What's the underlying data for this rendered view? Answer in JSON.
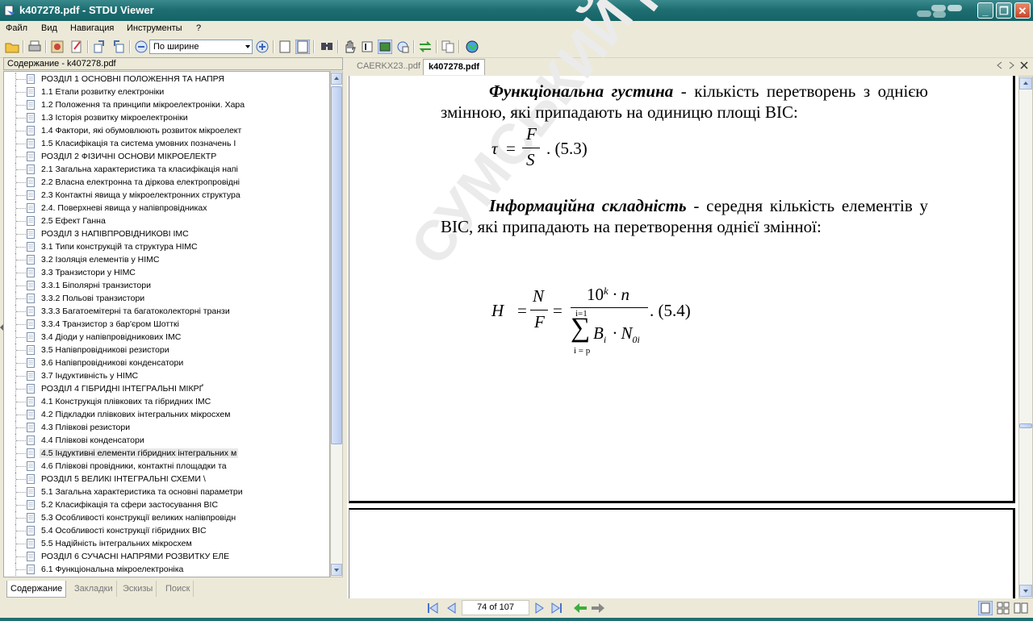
{
  "window": {
    "title": "k407278.pdf - STDU Viewer",
    "buttons": {
      "minimize": "_",
      "maximize": "❐",
      "close": "✕"
    }
  },
  "menu": [
    {
      "label": "Файл"
    },
    {
      "label": "Вид"
    },
    {
      "label": "Навигация"
    },
    {
      "label": "Инструменты"
    },
    {
      "label": "?"
    }
  ],
  "toolbar": {
    "zoom_value": "По ширине"
  },
  "contents_panel": {
    "title": "Содержание - k407278.pdf",
    "items": [
      {
        "label": "РОЗДІЛ 1 ОСНОВНІ ПОЛОЖЕННЯ ТА НАПРЯ"
      },
      {
        "label": "1.1 Етапи розвитку електроніки"
      },
      {
        "label": "1.2 Положення та принципи мікроелектроніки. Хара"
      },
      {
        "label": "1.3 Історія розвитку мікроелектроніки"
      },
      {
        "label": "1.4 Фактори, які обумовлюють розвиток  мікроелект"
      },
      {
        "label": "1.5 Класифікація та система умовних позначень І"
      },
      {
        "label": "РОЗДІЛ 2 ФІЗИЧНІ ОСНОВИ МІКРОЕЛЕКТР"
      },
      {
        "label": "2.1 Загальна характеристика та класифікація напі"
      },
      {
        "label": "2.2 Власна електронна та діркова електропровідні"
      },
      {
        "label": "2.3 Контактні явища у мікроелектронних структура"
      },
      {
        "label": "2.4. Поверхневі явища у напівпровідниках"
      },
      {
        "label": "2.5 Ефект Ганна"
      },
      {
        "label": "РОЗДІЛ 3 НАПІВПРОВІДНИКОВІ ІМС"
      },
      {
        "label": "3.1 Типи конструкцій та структура НІМС"
      },
      {
        "label": "3.2 Ізоляція елементів у НІМС"
      },
      {
        "label": "3.3 Транзистори у НІМС"
      },
      {
        "label": "3.3.1 Біполярні транзистори"
      },
      {
        "label": "3.3.2 Польові транзистори"
      },
      {
        "label": "3.3.3 Багатоемітерні та багатоколекторні  транзи"
      },
      {
        "label": "3.3.4 Транзистор з бар'єром Шотткі"
      },
      {
        "label": "3.4 Діоди у напівпровідникових ІМС"
      },
      {
        "label": "3.5 Напівпровідникові резистори"
      },
      {
        "label": "3.6 Напівпровідникові конденсатори"
      },
      {
        "label": "3.7 Індуктивність у НІМС"
      },
      {
        "label": "РОЗДІЛ 4 ГІБРИДНІ ІНТЕГРАЛЬНІ МІКРҐ"
      },
      {
        "label": "4.1 Конструкція плівкових та гібридних ІМС"
      },
      {
        "label": "4.2 Підкладки плівкових інтегральних мікросхем"
      },
      {
        "label": "4.3 Плівкові резистори"
      },
      {
        "label": "4.4 Плівкові конденсатори"
      },
      {
        "label": "4.5 Індуктивні елементи гібридних інтегральних м",
        "selected": true
      },
      {
        "label": "4.6 Плівкові провідники, контактні площадки та"
      },
      {
        "label": "РОЗДІЛ 5 ВЕЛИКІ ІНТЕГРАЛЬНІ СХЕМИ \\"
      },
      {
        "label": "5.1 Загальна характеристика та основні параметри"
      },
      {
        "label": "5.2 Класифікація та сфери застосування ВІС"
      },
      {
        "label": "5.3 Особливості конструкції великих напівпровідн"
      },
      {
        "label": "5.4 Особливості конструкції гібридних ВІС"
      },
      {
        "label": "5.5 Надійність інтегральних мікросхем"
      },
      {
        "label": "РОЗДІЛ 6 СУЧАСНІ НАПРЯМИ РОЗВИТКУ ЕЛЕ"
      },
      {
        "label": "6.1 Функціональна мікроелектроніка"
      }
    ],
    "tabs": [
      {
        "label": "Содержание",
        "active": true
      },
      {
        "label": "Закладки"
      },
      {
        "label": "Эскизы"
      },
      {
        "label": "Поиск"
      }
    ]
  },
  "document_tabs": [
    {
      "label": "CAERKX23..pdf"
    },
    {
      "label": "k407278.pdf",
      "active": true
    }
  ],
  "page": {
    "para1_term": "Функціональна густина",
    "para1_text": " - кількість перетворень з однією змінною, які припадають на одиницю площі ВІС:",
    "eq1": {
      "lhs": "τ",
      "num": "F",
      "den": "S",
      "label": ". (5.3)"
    },
    "para2_term": "Інформаційна складність",
    "para2_text": " - середня кількість елементів у ВІС, які припадають на перетворення однієї змінної:",
    "eq2": {
      "lhs": "H",
      "num1": "N",
      "den1": "F",
      "num2_base": "10",
      "num2_exp": "k",
      "num2_rest": " · n",
      "sum_top": "i=1",
      "sum_bottom": "i = p",
      "den2_b": "B",
      "den2_b_sub": "i",
      "den2_n": " · N",
      "den2_n_sub": "0i",
      "label": ". (5.4)"
    },
    "watermark": "СУМСЬКИЙ ДЕР"
  },
  "navigation": {
    "page_indicator": "74 of 107"
  }
}
